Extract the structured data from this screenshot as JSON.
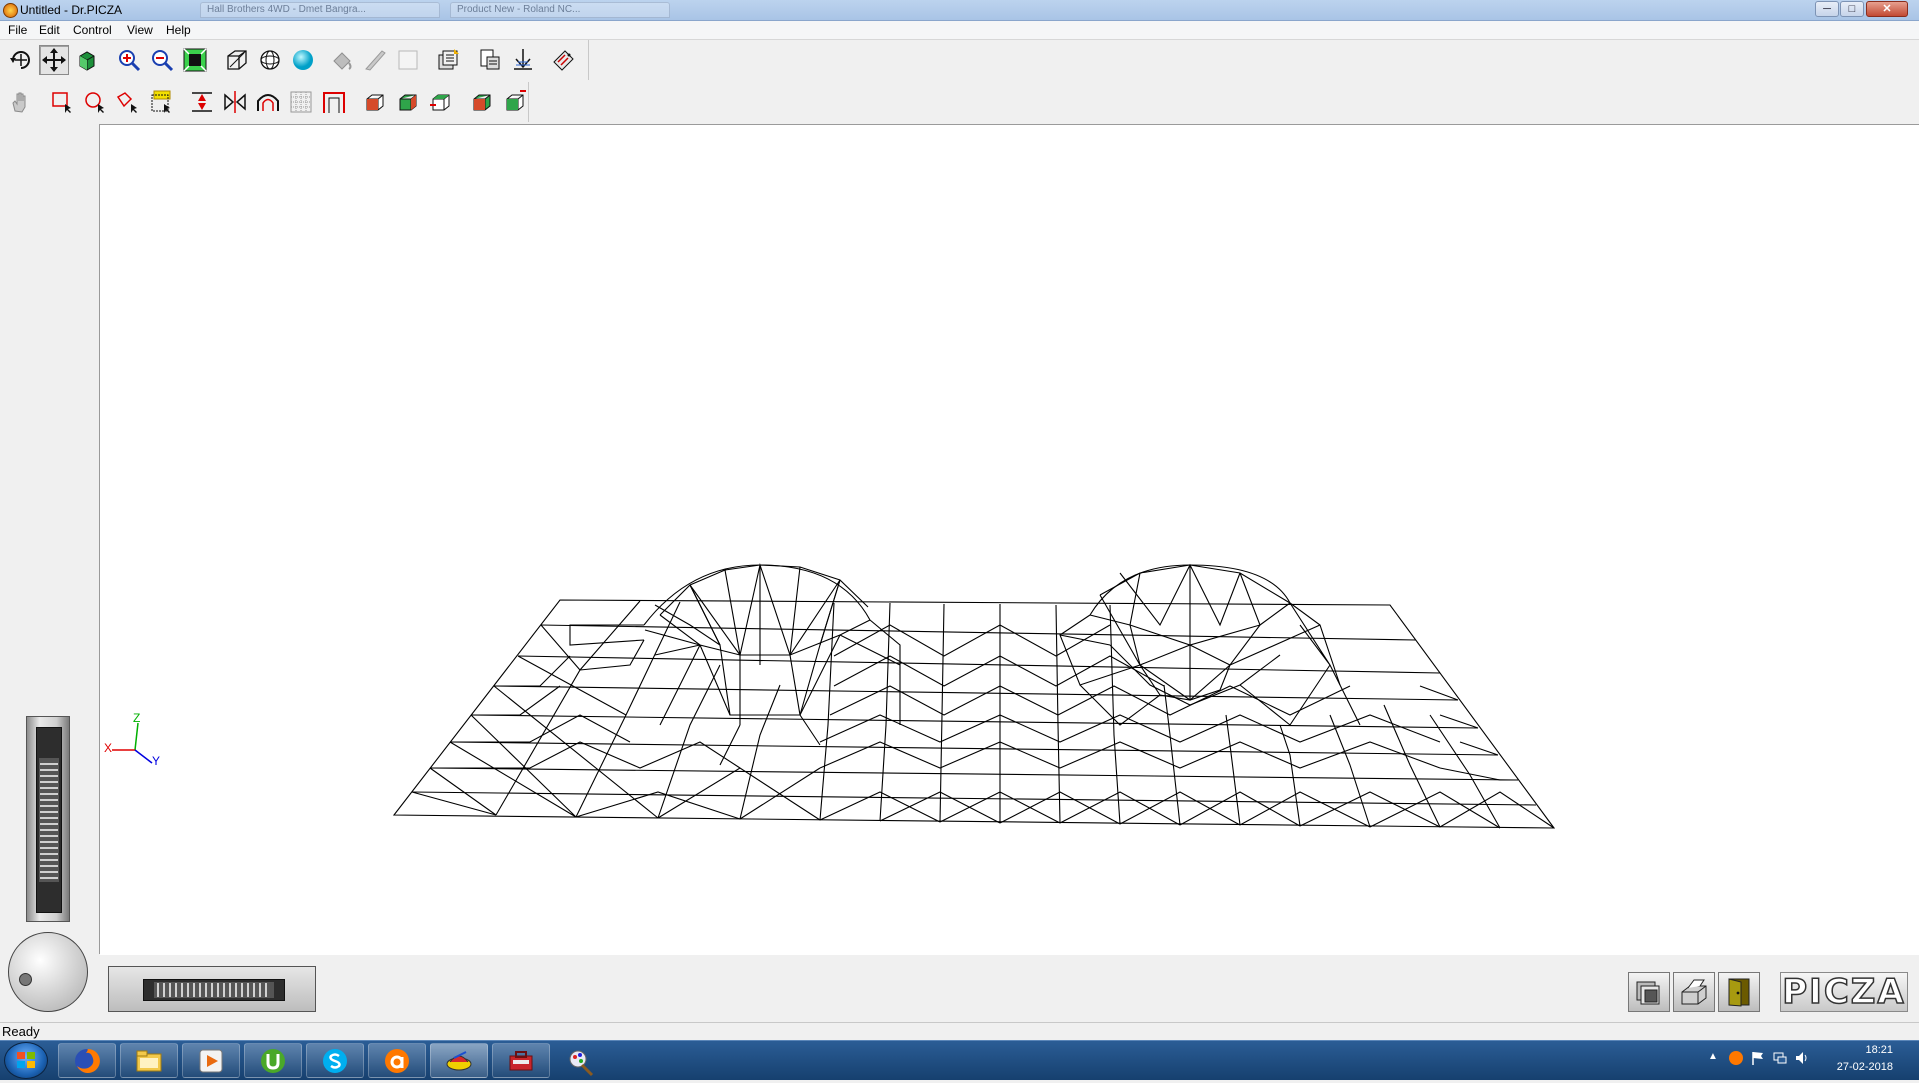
{
  "window": {
    "title": "Untitled - Dr.PICZA"
  },
  "background_tabs": [
    "Hall Brothers 4WD - Dmet Bangra...",
    "Product New - Roland NC..."
  ],
  "window_controls": {
    "minimize": "─",
    "maximize": "□",
    "close": "✕"
  },
  "menu": [
    {
      "label": "File"
    },
    {
      "label": "Edit"
    },
    {
      "label": "Control"
    },
    {
      "label": "View"
    },
    {
      "label": "Help"
    }
  ],
  "toolbar1": [
    {
      "icon": "rotate-icon"
    },
    {
      "icon": "move-icon",
      "pressed": true
    },
    {
      "icon": "color-cube-icon"
    },
    {
      "icon": "zoom-in-icon"
    },
    {
      "icon": "zoom-out-icon"
    },
    {
      "icon": "fit-to-window-icon"
    },
    {
      "icon": "wireframe-cube-icon"
    },
    {
      "icon": "wireframe-sphere-icon"
    },
    {
      "icon": "shaded-sphere-icon"
    },
    {
      "icon": "disabled-fill-icon"
    },
    {
      "icon": "disabled-knife-icon"
    },
    {
      "icon": "disabled-box-icon"
    },
    {
      "icon": "scan-setup-icon"
    },
    {
      "icon": "print-preview-icon"
    },
    {
      "icon": "scan-start-icon"
    },
    {
      "icon": "export-data-icon"
    }
  ],
  "toolbar2": [
    {
      "icon": "pan-hand-icon"
    },
    {
      "icon": "select-rectangle-icon"
    },
    {
      "icon": "select-circle-icon"
    },
    {
      "icon": "select-polygon-icon"
    },
    {
      "icon": "select-all-icon"
    },
    {
      "icon": "trim-height-icon"
    },
    {
      "icon": "mirror-icon"
    },
    {
      "icon": "arch-icon"
    },
    {
      "icon": "grid-mesh-icon"
    },
    {
      "icon": "frame-icon"
    },
    {
      "icon": "box-view-front-icon"
    },
    {
      "icon": "box-view-side-icon"
    },
    {
      "icon": "box-view-top-icon"
    },
    {
      "icon": "box-view-iso-icon"
    },
    {
      "icon": "box-view-back-icon"
    }
  ],
  "axis_indicator": {
    "x": "X",
    "y": "Y",
    "z": "Z",
    "x_color": "#e00000",
    "y_color": "#0000e0",
    "z_color": "#00b000"
  },
  "bottom_buttons": [
    {
      "icon": "layers-icon"
    },
    {
      "icon": "printer-icon"
    },
    {
      "icon": "exit-door-icon"
    }
  ],
  "logo": {
    "text": "PICZA"
  },
  "status": {
    "text": "Ready"
  },
  "taskbar": {
    "apps": [
      {
        "icon": "firefox-icon"
      },
      {
        "icon": "file-explorer-icon"
      },
      {
        "icon": "media-player-icon"
      },
      {
        "icon": "utorrent-icon"
      },
      {
        "icon": "skype-icon"
      },
      {
        "icon": "avast-icon"
      },
      {
        "icon": "drpicza-icon"
      },
      {
        "icon": "toolbox-icon"
      },
      {
        "icon": "paint-icon"
      }
    ],
    "time": "18:21",
    "date": "27-02-2018"
  }
}
